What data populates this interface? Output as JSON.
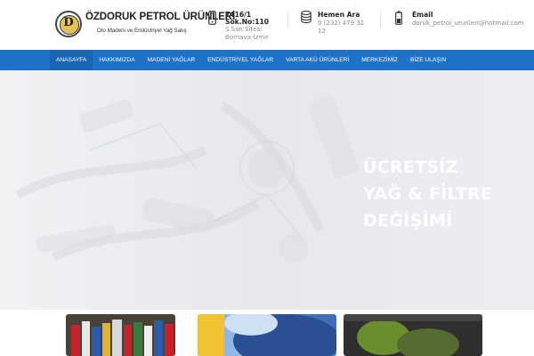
{
  "brand": {
    "logo_letter": "D",
    "title": "ÖZDORUK PETROL ÜRÜNLERİ",
    "subtitle": "Oto Madeni ve Endüstriyel Yağ Satış"
  },
  "header_info": {
    "address": {
      "icon": "mobile-phone-icon",
      "title": "7416/1 Sok.No:110",
      "title_line1": "7416/1",
      "title_line2": "Sok.No:110",
      "line1": "S.San.Sitesi",
      "line2": "Bornava-İzmir"
    },
    "phone": {
      "icon": "database-icon",
      "title": "Hemen Ara",
      "line1": "0 (232) 479 32",
      "line2": "12"
    },
    "email": {
      "icon": "battery-icon",
      "title": "Email",
      "line1": "doruk_petrol_urunleri@hotmail.com"
    }
  },
  "nav": {
    "items": [
      {
        "label": "ANASAYFA",
        "active": true
      },
      {
        "label": "HAKKIMIZDA",
        "active": false
      },
      {
        "label": "MADENİ YAĞLAR",
        "active": false
      },
      {
        "label": "ENDÜSTRİYEL YAĞLAR",
        "active": false
      },
      {
        "label": "VARTA AKÜ ÜRÜNLERİ",
        "active": false
      },
      {
        "label": "MERKEZİMİZ",
        "active": false
      },
      {
        "label": "BİZE ULAŞIN",
        "active": false
      }
    ]
  },
  "hero": {
    "line1": "ÜCRETSİZ",
    "line2": "YAĞ & FİLTRE",
    "line3": "DEĞİŞİMİ"
  },
  "colors": {
    "nav_bg": "#1e73c9",
    "nav_active": "#1966b4",
    "hero_bg": "#eeeff2"
  }
}
